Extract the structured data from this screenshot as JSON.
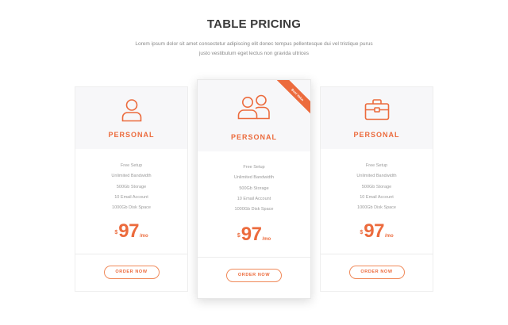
{
  "header": {
    "title": "TABLE PRICING",
    "subtitle": "Lorem ipsum dolor sit amet consectetur adipiscing elit donec tempus pellentesque dui vel tristique purus justo vestibulum eget lectus non gravida ultrices"
  },
  "colors": {
    "accent": "#ec6b3d",
    "card_top_bg": "#f7f7f9",
    "feature_text": "#9a9a9a",
    "title_text": "#3a3a3a"
  },
  "plans": [
    {
      "icon": "user-icon",
      "name": "PERSONAL",
      "features": [
        "Free Setup",
        "Unlimited Bandwidth",
        "500Gb Storage",
        "10 Email Account",
        "1000Gb Disk Space"
      ],
      "currency": "$",
      "price": "97",
      "period": "/mo",
      "button": "ORDER NOW"
    },
    {
      "icon": "users-icon",
      "name": "PERSONAL",
      "ribbon": "Best Value",
      "features": [
        "Free Setup",
        "Unlimited Bandwidth",
        "500Gb Storage",
        "10 Email Account",
        "1000Gb Disk Space"
      ],
      "currency": "$",
      "price": "97",
      "period": "/mo",
      "button": "ORDER NOW"
    },
    {
      "icon": "briefcase-icon",
      "name": "PERSONAL",
      "features": [
        "Free Setup",
        "Unlimited Bandwidth",
        "500Gb Storage",
        "10 Email Account",
        "1000Gb Disk Space"
      ],
      "currency": "$",
      "price": "97",
      "period": "/mo",
      "button": "ORDER NOW"
    }
  ]
}
